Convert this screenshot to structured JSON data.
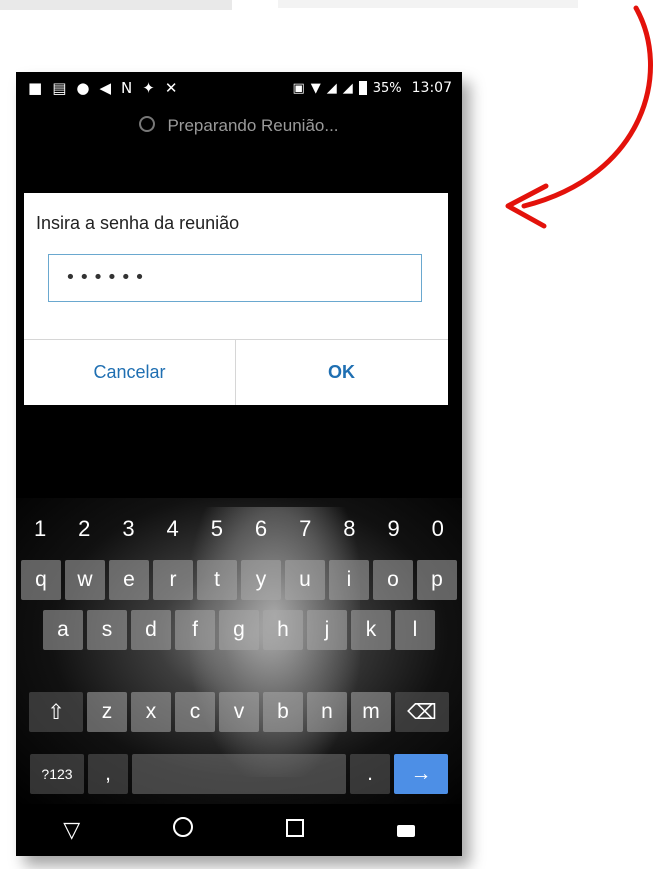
{
  "statusbar": {
    "icons": [
      "message-icon",
      "news-icon",
      "facebook-icon",
      "share-icon",
      "netflix-icon",
      "twitter-icon",
      "signal-icon",
      "cast-icon",
      "wifi-icon",
      "cell-signal-icon",
      "cell-signal-x-icon",
      "battery-icon"
    ],
    "battery": "35%",
    "time": "13:07"
  },
  "header": {
    "preparing": "Preparando Reunião..."
  },
  "dialog": {
    "title": "Insira a senha da reunião",
    "password_value": "••••••",
    "cancel_label": "Cancelar",
    "ok_label": "OK"
  },
  "keyboard": {
    "numbers": [
      "1",
      "2",
      "3",
      "4",
      "5",
      "6",
      "7",
      "8",
      "9",
      "0"
    ],
    "row1": [
      "q",
      "w",
      "e",
      "r",
      "t",
      "y",
      "u",
      "i",
      "o",
      "p"
    ],
    "row2": [
      "a",
      "s",
      "d",
      "f",
      "g",
      "h",
      "j",
      "k",
      "l"
    ],
    "row3": [
      "z",
      "x",
      "c",
      "v",
      "b",
      "n",
      "m"
    ],
    "symbols_label": "?123",
    "comma_label": ",",
    "period_label": ".",
    "shift_icon": "shift-icon",
    "backspace_icon": "backspace-icon",
    "enter_icon": "arrow-right-icon"
  },
  "navbar": {
    "back_icon": "back-triangle-icon",
    "home_icon": "home-circle-icon",
    "recents_icon": "recents-square-icon",
    "keyboard_icon": "keyboard-icon"
  },
  "colors": {
    "accent": "#1f6fb2",
    "enter_key": "#4d8fe6",
    "annotation_arrow": "#e3120b"
  }
}
